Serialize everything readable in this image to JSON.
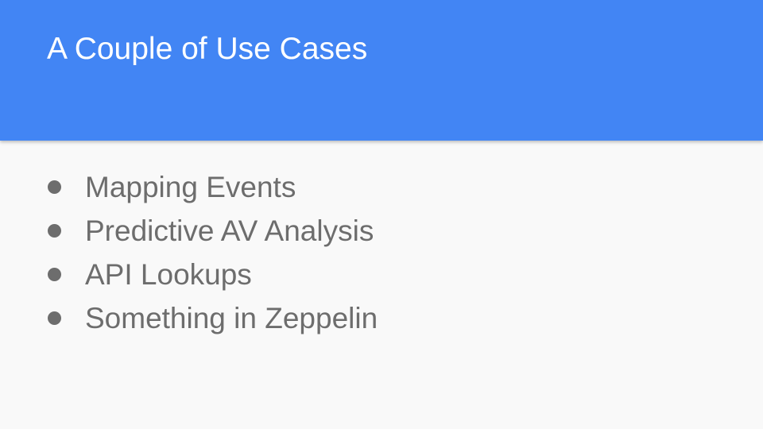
{
  "slide": {
    "title": "A Couple of Use Cases",
    "bullets": [
      "Mapping Events",
      "Predictive AV Analysis",
      "API Lookups",
      "Something in Zeppelin"
    ]
  },
  "colors": {
    "header_background": "#4285f4",
    "title_text": "#ffffff",
    "body_background": "#f9f9f9",
    "bullet_text": "#6d6d6d"
  }
}
